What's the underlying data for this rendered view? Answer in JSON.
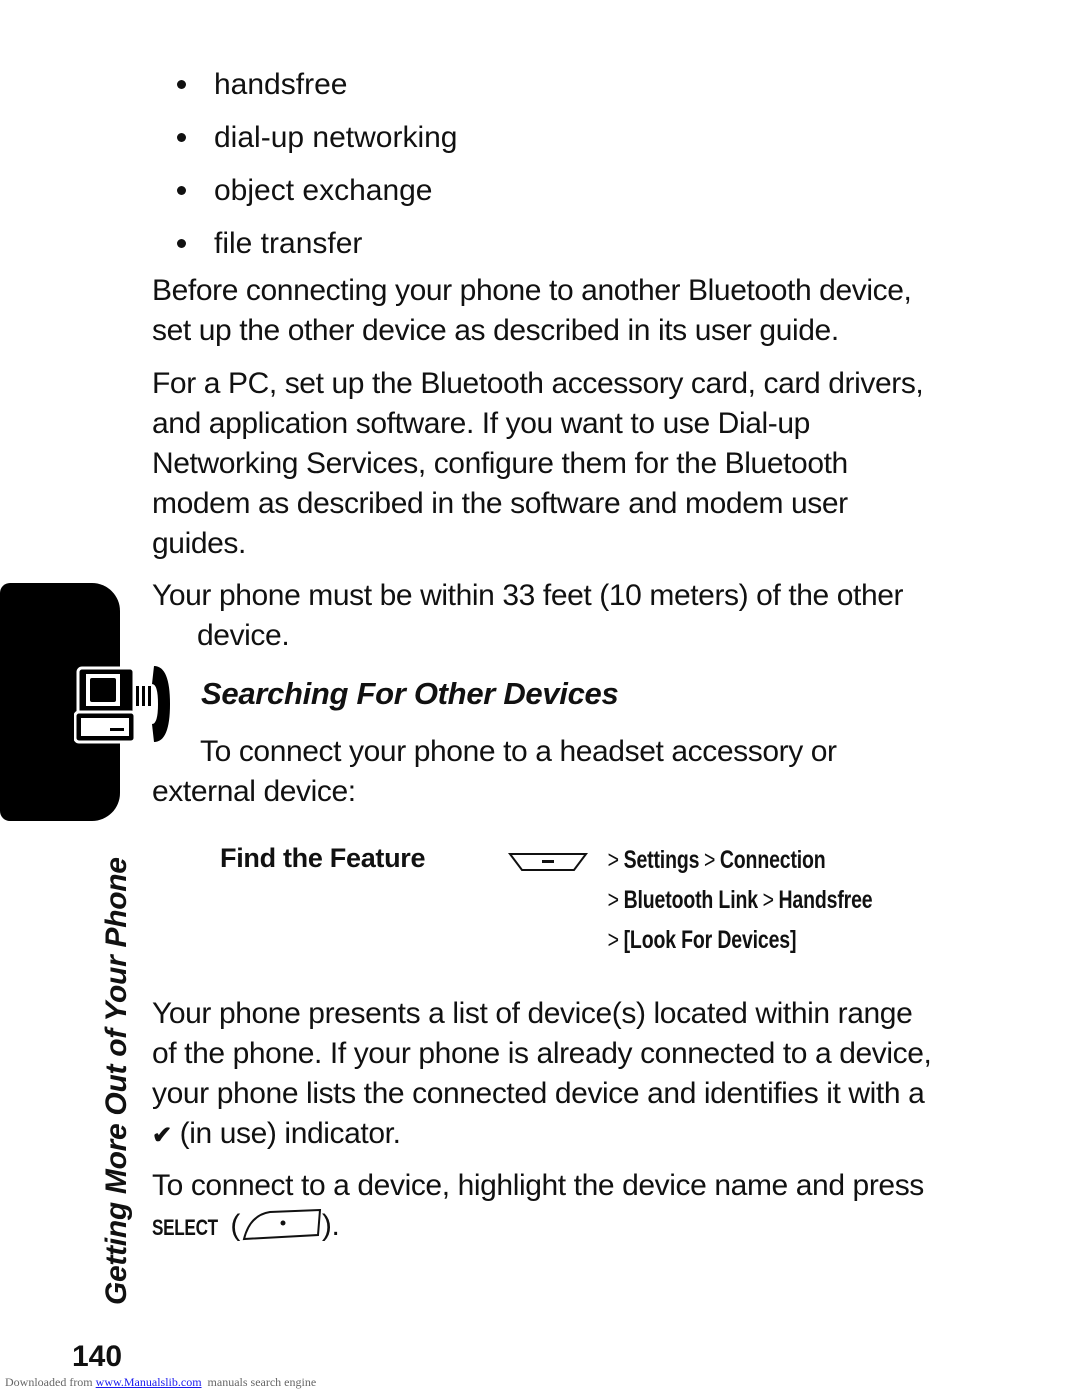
{
  "bullets": [
    "handsfree",
    "dial-up networking",
    "object exchange",
    "file transfer"
  ],
  "paragraphs": {
    "before_connecting": "Before connecting your phone to another Bluetooth device, set up the other device as described in its user guide.",
    "for_pc": "For a PC, set up the Bluetooth accessory card, card drivers, and application software. If you want to use Dial-up Networking Services, configure them for the Bluetooth modem as described in the software and modem user guides.",
    "range": "Your phone must be within 33 feet (10 meters) of the other device.",
    "intro": "To connect your phone to a headset accessory or external device:",
    "presents_list_a": "Your phone presents a list of device(s) located within range of the phone. If your phone is already connected to a device, your phone lists the connected device and identifies it with a",
    "presents_list_b": "(in use) indicator.",
    "connect_a": "To connect to a device, highlight the device name and press",
    "connect_key": "SELECT",
    "connect_b": ")."
  },
  "section": {
    "heading": "Searching For Other Devices",
    "tab_icon": "pc-phone-connection-icon",
    "side_title": "Getting More Out of Your Phone"
  },
  "find_feature": {
    "label": "Find the Feature",
    "key_icon": "menu-key-icon",
    "path": [
      [
        "Settings",
        "Connection"
      ],
      [
        "Bluetooth Link",
        "Handsfree"
      ],
      [
        "[Look For Devices]"
      ]
    ]
  },
  "indicator_icon": "checkmark-icon",
  "select_key_icon": "select-softkey-icon",
  "page_number": "140",
  "footer": {
    "prefix": "Downloaded from ",
    "link": "www.Manualslib.com",
    "suffix": "  manuals search engine"
  }
}
